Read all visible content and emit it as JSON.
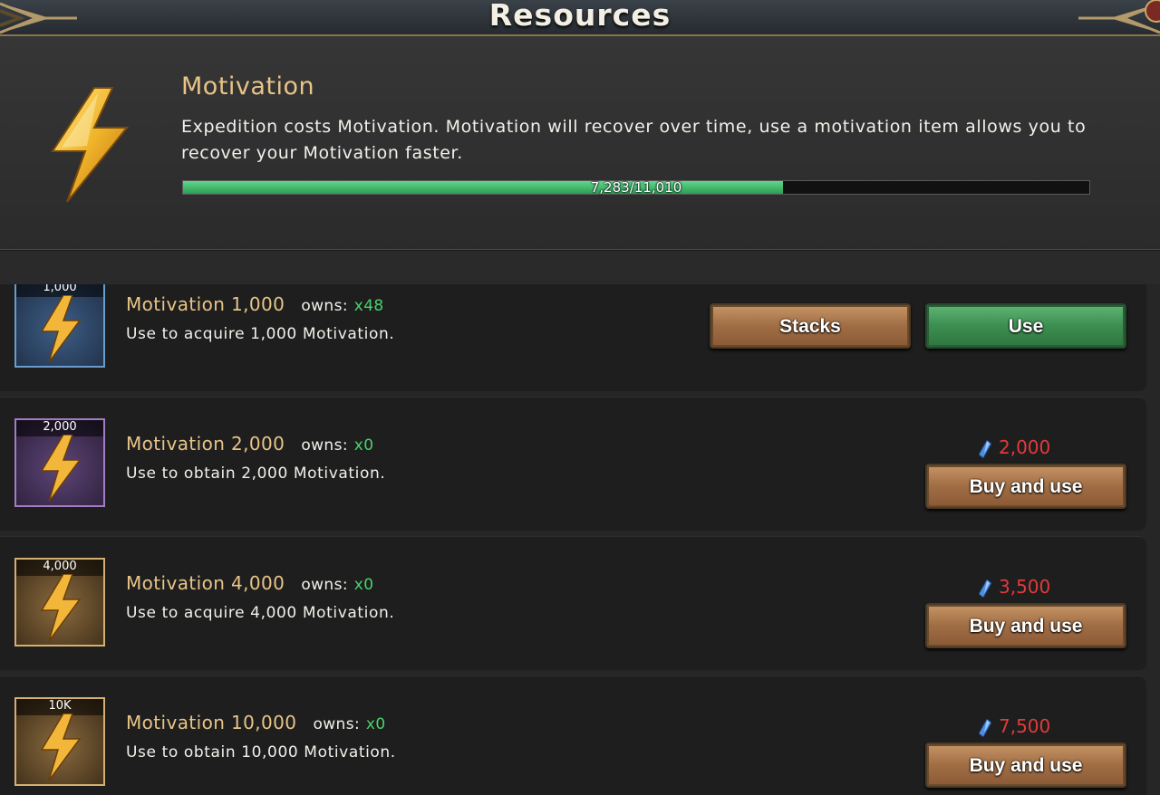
{
  "header": {
    "title": "Resources"
  },
  "resource": {
    "name": "Motivation",
    "description": "Expedition costs Motivation. Motivation will recover over time, use a motivation item allows you to recover your Motivation faster.",
    "current": 7283,
    "max": 11010,
    "progress_text": "7,283/11,010",
    "progress_fraction": 0.6615
  },
  "labels": {
    "owns": "owns:"
  },
  "items": [
    {
      "name": "Motivation 1,000",
      "badge": "1,000",
      "owns": "x48",
      "description": "Use to acquire 1,000 Motivation.",
      "frame": "blue",
      "stacks_label": "Stacks",
      "use_label": "Use"
    },
    {
      "name": "Motivation 2,000",
      "badge": "2,000",
      "owns": "x0",
      "description": "Use to obtain 2,000 Motivation.",
      "frame": "purple",
      "price": "2,000",
      "buy_label": "Buy and use"
    },
    {
      "name": "Motivation 4,000",
      "badge": "4,000",
      "owns": "x0",
      "description": "Use to acquire 4,000 Motivation.",
      "frame": "gold",
      "price": "3,500",
      "buy_label": "Buy and use"
    },
    {
      "name": "Motivation 10,000",
      "badge": "10K",
      "owns": "x0",
      "description": "Use to obtain 10,000 Motivation.",
      "frame": "gold",
      "price": "7,500",
      "buy_label": "Buy and use"
    }
  ],
  "icons": {
    "resource": "lightning-bolt-icon",
    "currency": "blue-gem-icon"
  },
  "colors": {
    "title_gold": "#e8c487",
    "owns_green": "#49d36c",
    "price_red": "#e23a3a",
    "progress_green": "#3cc06a"
  }
}
